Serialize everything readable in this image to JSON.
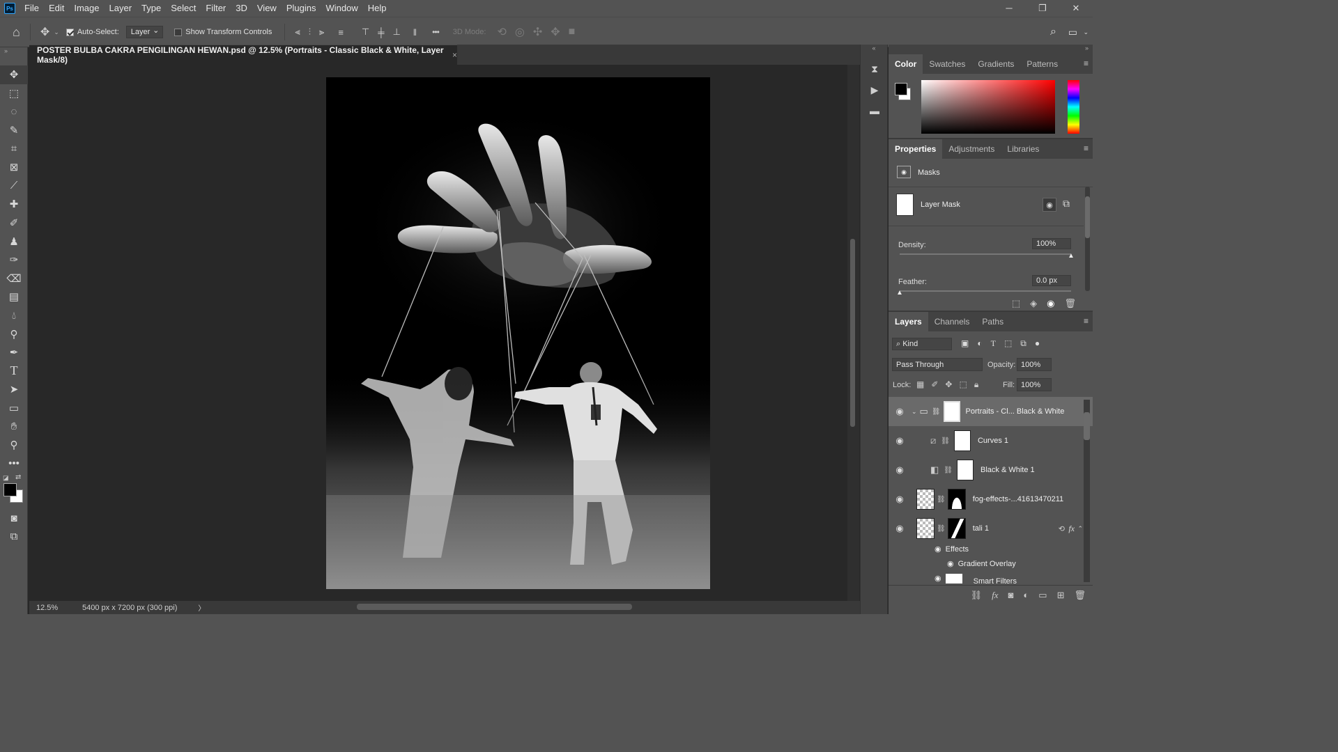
{
  "app": {
    "logo": "Ps"
  },
  "menu": [
    "File",
    "Edit",
    "Image",
    "Layer",
    "Type",
    "Select",
    "Filter",
    "3D",
    "View",
    "Plugins",
    "Window",
    "Help"
  ],
  "window_controls": {
    "minimize": "─",
    "restore": "❐",
    "close": "✕"
  },
  "options_bar": {
    "auto_select_label": "Auto-Select:",
    "auto_select_checked": true,
    "auto_select_target": "Layer",
    "show_transform_label": "Show Transform Controls",
    "show_transform_checked": false,
    "more": "•••",
    "three_d_mode_label": "3D Mode:"
  },
  "document": {
    "tab_title": "POSTER BULBA CAKRA PENGILINGAN HEWAN.psd @ 12.5% (Portraits - Classic Black & White, Layer Mask/8)",
    "close_glyph": "×"
  },
  "status_bar": {
    "zoom": "12.5%",
    "doc_info": "5400 px x 7200 px (300 ppi)",
    "arrow": "〉"
  },
  "color_panel": {
    "tabs": [
      "Color",
      "Swatches",
      "Gradients",
      "Patterns"
    ],
    "active_tab": "Color",
    "foreground": "#000000",
    "background": "#ffffff",
    "hue_color": "#ff0000"
  },
  "properties_panel": {
    "tabs": [
      "Properties",
      "Adjustments",
      "Libraries"
    ],
    "active_tab": "Properties",
    "section_label": "Masks",
    "mask_label": "Layer Mask",
    "density_label": "Density:",
    "density_value": "100%",
    "density_level": 1.0,
    "feather_label": "Feather:",
    "feather_value": "0.0 px",
    "feather_level": 0.0
  },
  "layers_panel": {
    "tabs": [
      "Layers",
      "Channels",
      "Paths"
    ],
    "active_tab": "Layers",
    "filter_kind": "Kind",
    "blend_mode": "Pass Through",
    "opacity_label": "Opacity:",
    "opacity_value": "100%",
    "lock_label": "Lock:",
    "fill_label": "Fill:",
    "fill_value": "100%",
    "layers": [
      {
        "name": "Portraits - Cl... Black & White",
        "type": "group",
        "selected": true
      },
      {
        "name": "Curves 1",
        "type": "curves"
      },
      {
        "name": "Black & White 1",
        "type": "bw"
      },
      {
        "name": "fog-effects-...41613470211",
        "type": "smart"
      },
      {
        "name": "tali 1",
        "type": "smart",
        "fx": "fx"
      }
    ],
    "effects_label": "Effects",
    "effect_item": "Gradient Overlay",
    "smart_filters_label": "Smart Filters"
  }
}
